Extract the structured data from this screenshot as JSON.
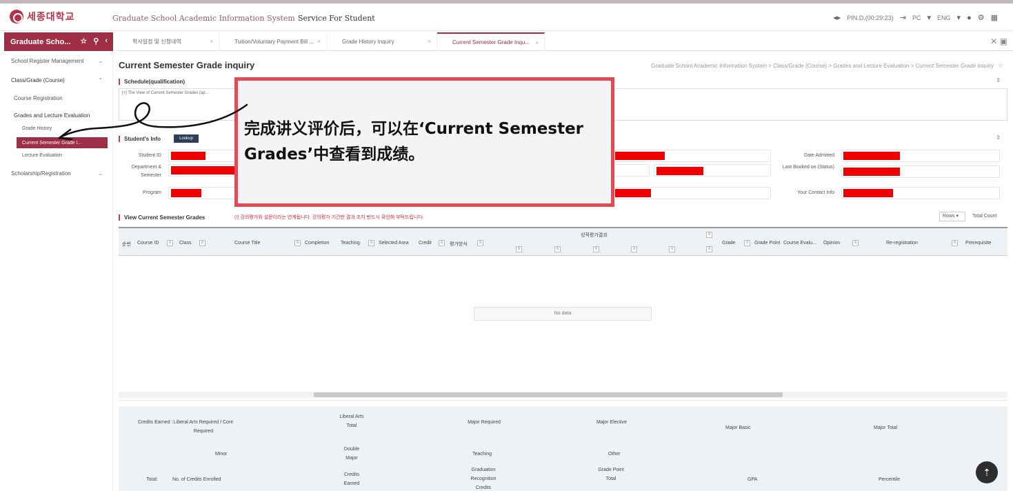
{
  "header": {
    "logo_text": "세종대학교",
    "system_title": "Graduate School Academic Information System",
    "service_title": "Service For Student",
    "user": "PIN.D.(00:29:23)",
    "lang_pc": "PC",
    "lang_eng": "ENG"
  },
  "sidebar": {
    "head_title": "Graduate Scho...",
    "items": {
      "school_register": "School Register Management",
      "class_grade": "Class/Grade (Course)",
      "course_registration": "Course Registration",
      "grades_lecture_eval": "Grades and Lecture Evaluation",
      "grade_history": "Grade History",
      "current_semester": "Current Semester Grade I...",
      "lecture_evaluation": "Lecture Evaluation",
      "scholarship": "Scholarship/Registration"
    }
  },
  "tabs": [
    {
      "label": "학사일정 및 신청내역"
    },
    {
      "label": "Tuition/Voluntary Payment Bill ..."
    },
    {
      "label": "Grade History Inquiry"
    },
    {
      "label": "Current Semester Grade Inqu..."
    }
  ],
  "page": {
    "title": "Current Semester Grade inquiry",
    "breadcrumb": "Graduate School Academic Information System > Class/Grade (Course) > Grades and Lecture Evaluation > Current Semester Grade inquiry",
    "schedule_title": "Schedule(qualification)",
    "schedule_row": "[+] The View of Current Semester Grades (ap...",
    "student_info_title": "Student's Info",
    "student_info_btn": "Lookup",
    "labels": {
      "student_id": "Student ID",
      "department": "Department & Semester",
      "program": "Program",
      "date_admitted": "Date Admitted",
      "last_booked": "Last Booked on (Status)",
      "contact": "Your Contact Info"
    },
    "grades_title": "View Current Semester Grades",
    "grades_notice": "(!) 강의평가와 설문이라는 연계됩니다. 강의평가 기간만 결과 조치 반드시 확인해 부탁드립니다.",
    "rows_select": "Rows",
    "total_count": "Total Count"
  },
  "grid": {
    "group_header": "성적평가결과",
    "columns": {
      "no": "순번",
      "course_id": "Course ID",
      "class": "Class",
      "course_title": "Course Title",
      "completion": "Completion",
      "teaching": "Teaching",
      "selected_area": "Selected Area",
      "credit": "Credit",
      "eval_method": "평가방식",
      "grade": "Grade",
      "grade_point": "Grade Point",
      "course_eval": "Course Evalu...",
      "opinion": "Opinion",
      "re_registration": "Re-registration",
      "prerequisite": "Prerequisite"
    },
    "no_data": "No data"
  },
  "credits": {
    "credits_earned": "Credits Earned :",
    "liberal_core": "Liberal Arts Required / Core Required",
    "liberal_total": "Liberal Arts Total",
    "major_required": "Major Required",
    "major_elective": "Major Elective",
    "major_basic": "Major Basic",
    "major_total": "Major Total",
    "minor": "Minor",
    "double_major": "Double Major",
    "teaching": "Teaching",
    "other": "Other",
    "total": "Total:",
    "no_credits_enrolled": "No. of Credits Enrolled",
    "credits_earned2": "Credits Earned",
    "graduation_recognition": "Graduation Recognition Credits",
    "grade_point_total": "Grade Point Total",
    "gpa": "GPA",
    "percentile": "Percentile"
  },
  "callout": {
    "text": "完成讲义评价后，可以在‘Current Semester Grades’中查看到成绩。"
  },
  "colors": {
    "brand": "#9e2e46",
    "callout_border": "#e24b55",
    "redacted": "#ee0000"
  }
}
